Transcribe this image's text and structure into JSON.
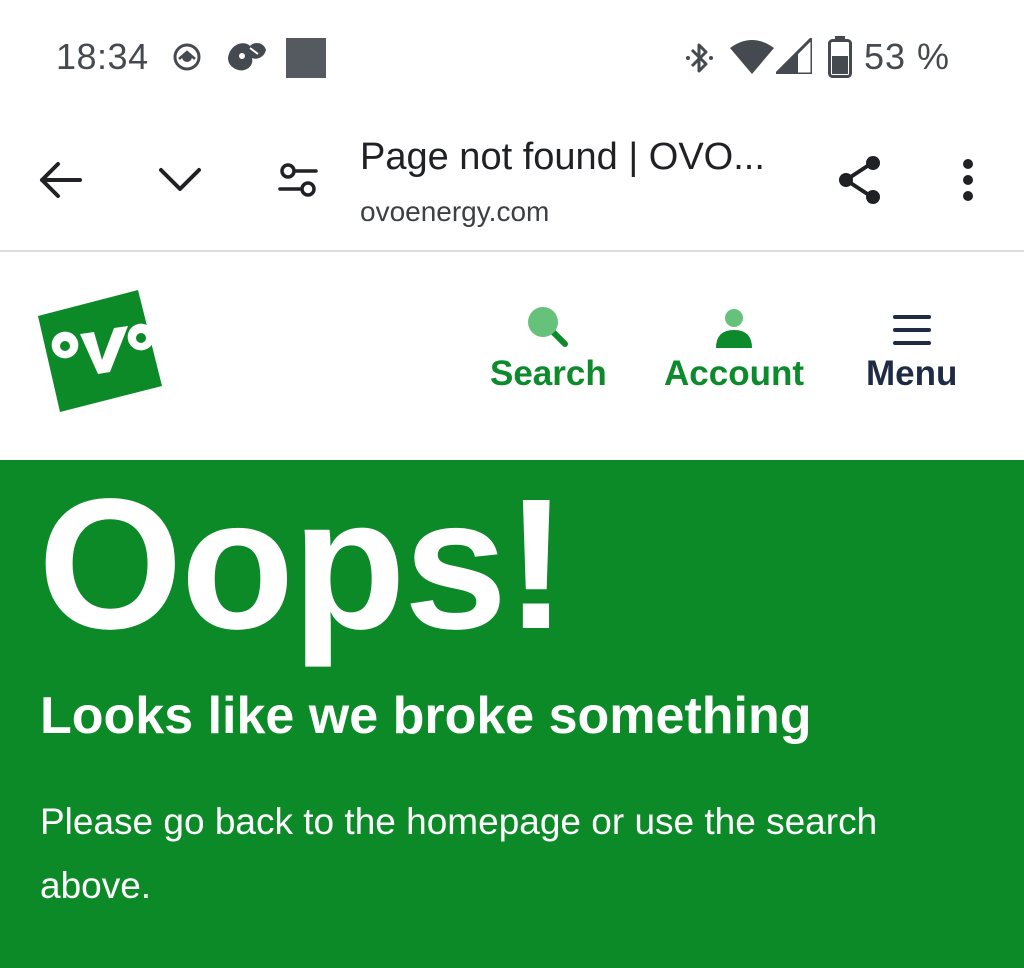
{
  "status_bar": {
    "time": "18:34",
    "battery_percent": "53 %",
    "icons": [
      "skoda-icon",
      "feather-icon",
      "square-notification-icon",
      "bluetooth-icon",
      "wifi-icon",
      "cell-signal-icon",
      "battery-icon"
    ]
  },
  "browser": {
    "page_title": "Page not found | OVO...",
    "url": "ovoenergy.com",
    "icons": [
      "back-arrow-icon",
      "chevron-down-icon",
      "site-settings-icon",
      "share-icon",
      "more-vert-icon"
    ]
  },
  "site_header": {
    "logo_icon": "ovo-logo-icon",
    "nav": {
      "search_label": "Search",
      "account_label": "Account",
      "menu_label": "Menu"
    }
  },
  "hero": {
    "title": "Oops!",
    "subtitle": "Looks like we broke something",
    "body": "Please go back to the homepage or use the search above."
  },
  "colors": {
    "brand_green": "#0b8a27",
    "nav_green": "#0c8a2c",
    "search_icon_green": "#66c27a",
    "nav_dark": "#1f2a44",
    "status_text": "#444a50"
  }
}
